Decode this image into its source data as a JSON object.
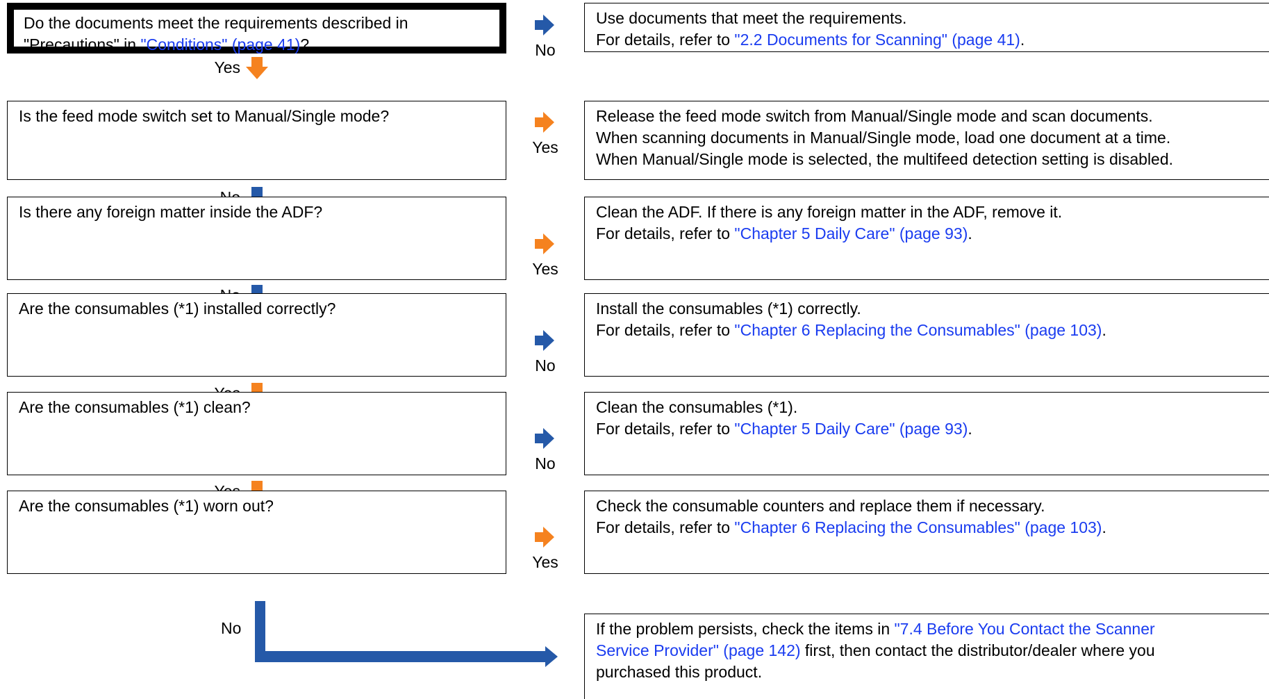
{
  "colors": {
    "orange": "#f5821f",
    "blue": "#2559a8",
    "link": "#1a3cf0"
  },
  "steps": [
    {
      "question": {
        "lines": [
          [
            {
              "text": "Do the documents meet the requirements described in"
            }
          ],
          [
            {
              "text": "\"Precautions\" in "
            },
            {
              "text": "\"Conditions\" (page 41)",
              "link": true
            },
            {
              "text": "?"
            }
          ]
        ]
      },
      "side": {
        "label": "No",
        "color": "blue"
      },
      "answer": {
        "lines": [
          [
            {
              "text": "Use documents that meet the requirements."
            }
          ],
          [
            {
              "text": "For details, refer to "
            },
            {
              "text": "\"2.2 Documents for Scanning\" (page 41)",
              "link": true
            },
            {
              "text": "."
            }
          ]
        ]
      },
      "next": {
        "label": "Yes",
        "color": "orange"
      }
    },
    {
      "question": {
        "lines": [
          [
            {
              "text": "Is the feed mode switch set to Manual/Single mode?"
            }
          ]
        ]
      },
      "side": {
        "label": "Yes",
        "color": "orange"
      },
      "answer": {
        "lines": [
          [
            {
              "text": "Release the feed mode switch from Manual/Single mode and scan documents."
            }
          ],
          [
            {
              "text": "When scanning documents in Manual/Single mode, load one document at a time."
            }
          ],
          [
            {
              "text": "When Manual/Single mode is selected, the multifeed detection setting is disabled."
            }
          ]
        ]
      },
      "next": {
        "label": "No",
        "color": "blue"
      }
    },
    {
      "question": {
        "lines": [
          [
            {
              "text": "Is there any foreign matter inside the ADF?"
            }
          ]
        ]
      },
      "side": {
        "label": "Yes",
        "color": "orange"
      },
      "answer": {
        "lines": [
          [
            {
              "text": "Clean the ADF. If there is any foreign matter in the ADF, remove it."
            }
          ],
          [
            {
              "text": "For details, refer to "
            },
            {
              "text": "\"Chapter 5 Daily Care\" (page 93)",
              "link": true
            },
            {
              "text": "."
            }
          ]
        ]
      },
      "next": {
        "label": "No",
        "color": "blue"
      }
    },
    {
      "question": {
        "lines": [
          [
            {
              "text": "Are the consumables (*1) installed correctly?"
            }
          ]
        ]
      },
      "side": {
        "label": "No",
        "color": "blue"
      },
      "answer": {
        "lines": [
          [
            {
              "text": "Install the consumables (*1) correctly."
            }
          ],
          [
            {
              "text": "For details, refer to "
            },
            {
              "text": "\"Chapter 6 Replacing the Consumables\" (page 103)",
              "link": true
            },
            {
              "text": "."
            }
          ]
        ]
      },
      "next": {
        "label": "Yes",
        "color": "orange"
      }
    },
    {
      "question": {
        "lines": [
          [
            {
              "text": "Are the consumables (*1) clean?"
            }
          ]
        ]
      },
      "side": {
        "label": "No",
        "color": "blue"
      },
      "answer": {
        "lines": [
          [
            {
              "text": "Clean the consumables (*1)."
            }
          ],
          [
            {
              "text": "For details, refer to "
            },
            {
              "text": "\"Chapter 5 Daily Care\" (page 93)",
              "link": true
            },
            {
              "text": "."
            }
          ]
        ]
      },
      "next": {
        "label": "Yes",
        "color": "orange"
      }
    },
    {
      "question": {
        "lines": [
          [
            {
              "text": "Are the consumables (*1) worn out?"
            }
          ]
        ]
      },
      "side": {
        "label": "Yes",
        "color": "orange"
      },
      "answer": {
        "lines": [
          [
            {
              "text": "Check the consumable counters and replace them if necessary."
            }
          ],
          [
            {
              "text": "For details, refer to "
            },
            {
              "text": "\"Chapter 6 Replacing the Consumables\" (page 103)",
              "link": true
            },
            {
              "text": "."
            }
          ]
        ]
      },
      "next": null
    }
  ],
  "final": {
    "label": "No",
    "lines": [
      [
        {
          "text": "If the problem persists, check the items in "
        },
        {
          "text": "\"7.4 Before You Contact the Scanner",
          "link": true
        }
      ],
      [
        {
          "text": "Service Provider\" (page 142)",
          "link": true
        },
        {
          "text": " first, then contact the distributor/dealer where you"
        }
      ],
      [
        {
          "text": "purchased this product."
        }
      ]
    ]
  }
}
